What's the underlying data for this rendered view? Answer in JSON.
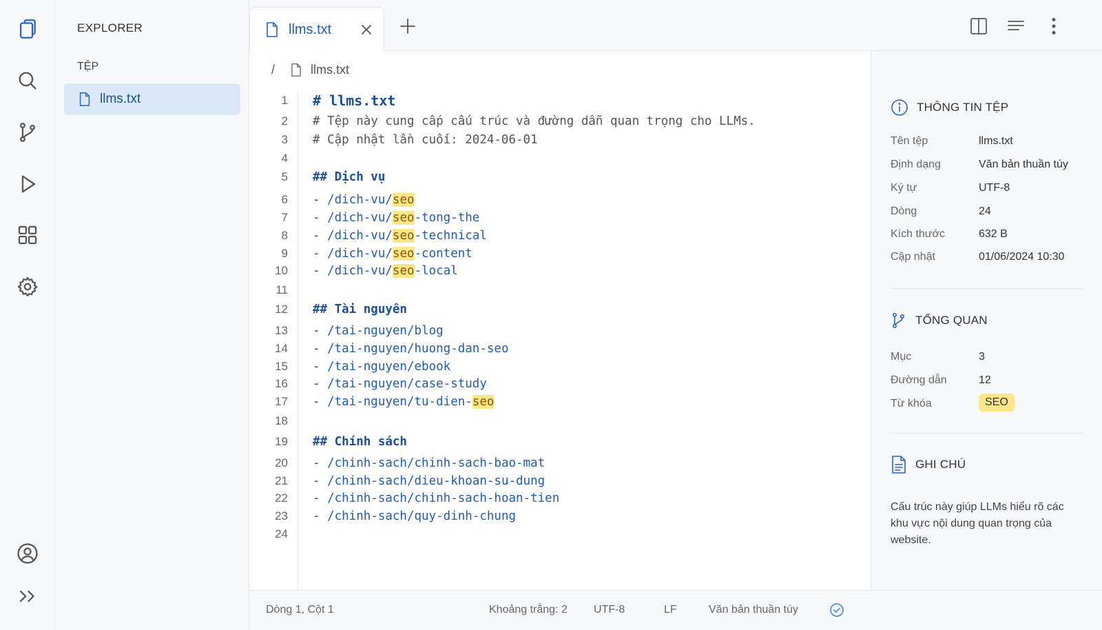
{
  "explorer": {
    "title": "EXPLORER",
    "section": "TỆP",
    "file": "llms.txt"
  },
  "tab": {
    "label": "llms.txt"
  },
  "breadcrumb": {
    "separator": "/",
    "file": "llms.txt"
  },
  "editor": {
    "lines": [
      {
        "n": "1",
        "parts": [
          [
            "h1",
            "# llms.txt"
          ]
        ]
      },
      {
        "n": "2",
        "parts": [
          [
            "cm",
            "# Tệp này cung cấp cấu trúc và đường dẫn quan trọng cho LLMs."
          ]
        ]
      },
      {
        "n": "3",
        "parts": [
          [
            "cm",
            "# Cập nhật lần cuối: 2024-06-01"
          ]
        ]
      },
      {
        "n": "4",
        "parts": []
      },
      {
        "n": "5",
        "parts": [
          [
            "h2",
            "## Dịch vụ"
          ]
        ]
      },
      {
        "n": "6",
        "parts": [
          [
            "dash",
            "- "
          ],
          [
            "path",
            "/dich-vu/"
          ],
          [
            "hl",
            "seo"
          ]
        ]
      },
      {
        "n": "7",
        "parts": [
          [
            "dash",
            "- "
          ],
          [
            "path",
            "/dich-vu/"
          ],
          [
            "hl",
            "seo"
          ],
          [
            "path",
            "-tong-the"
          ]
        ]
      },
      {
        "n": "8",
        "parts": [
          [
            "dash",
            "- "
          ],
          [
            "path",
            "/dich-vu/"
          ],
          [
            "hl",
            "seo"
          ],
          [
            "path",
            "-technical"
          ]
        ]
      },
      {
        "n": "9",
        "parts": [
          [
            "dash",
            "- "
          ],
          [
            "path",
            "/dich-vu/"
          ],
          [
            "hl",
            "seo"
          ],
          [
            "path",
            "-content"
          ]
        ]
      },
      {
        "n": "10",
        "parts": [
          [
            "dash",
            "- "
          ],
          [
            "path",
            "/dich-vu/"
          ],
          [
            "hl",
            "seo"
          ],
          [
            "path",
            "-local"
          ]
        ]
      },
      {
        "n": "11",
        "parts": []
      },
      {
        "n": "12",
        "parts": [
          [
            "h2",
            "## Tài nguyên"
          ]
        ]
      },
      {
        "n": "13",
        "parts": [
          [
            "dash",
            "- "
          ],
          [
            "path",
            "/tai-nguyen/blog"
          ]
        ]
      },
      {
        "n": "14",
        "parts": [
          [
            "dash",
            "- "
          ],
          [
            "path",
            "/tai-nguyen/huong-dan-seo"
          ]
        ]
      },
      {
        "n": "15",
        "parts": [
          [
            "dash",
            "- "
          ],
          [
            "path",
            "/tai-nguyen/ebook"
          ]
        ]
      },
      {
        "n": "16",
        "parts": [
          [
            "dash",
            "- "
          ],
          [
            "path",
            "/tai-nguyen/case-study"
          ]
        ]
      },
      {
        "n": "17",
        "parts": [
          [
            "dash",
            "- "
          ],
          [
            "path",
            "/tai-nguyen/tu-dien-"
          ],
          [
            "hl",
            "seo"
          ]
        ]
      },
      {
        "n": "18",
        "parts": []
      },
      {
        "n": "19",
        "parts": [
          [
            "h2",
            "## Chính sách"
          ]
        ]
      },
      {
        "n": "20",
        "parts": [
          [
            "dash",
            "- "
          ],
          [
            "path",
            "/chinh-sach/chinh-sach-bao-mat"
          ]
        ]
      },
      {
        "n": "21",
        "parts": [
          [
            "dash",
            "- "
          ],
          [
            "path",
            "/chinh-sach/dieu-khoan-su-dung"
          ]
        ]
      },
      {
        "n": "22",
        "parts": [
          [
            "dash",
            "- "
          ],
          [
            "path",
            "/chinh-sach/chinh-sach-hoan-tien"
          ]
        ]
      },
      {
        "n": "23",
        "parts": [
          [
            "dash",
            "- "
          ],
          [
            "path",
            "/chinh-sach/quy-dinh-chung"
          ]
        ]
      },
      {
        "n": "24",
        "parts": []
      }
    ]
  },
  "panel": {
    "file_info": {
      "title": "THÔNG TIN TỆP",
      "rows": [
        {
          "k": "Tên tệp",
          "v": "llms.txt"
        },
        {
          "k": "Định dạng",
          "v": "Văn bản thuần túy"
        },
        {
          "k": "Ký tự",
          "v": "UTF-8"
        },
        {
          "k": "Dòng",
          "v": "24"
        },
        {
          "k": "Kích thước",
          "v": "632 B"
        },
        {
          "k": "Cập nhật",
          "v": "01/06/2024 10:30"
        }
      ]
    },
    "overview": {
      "title": "TỔNG QUAN",
      "rows": [
        {
          "k": "Mục",
          "v": "3"
        },
        {
          "k": "Đường dẫn",
          "v": "12"
        }
      ],
      "keyword_label": "Từ khóa",
      "keyword": "SEO"
    },
    "notes": {
      "title": "GHI CHÚ",
      "text": "Cấu trúc này giúp LLMs hiểu rõ các khu vực nội dung quan trọng của website."
    }
  },
  "status": {
    "position": "Dòng 1, Cột 1",
    "indent": "Khoảng trắng: 2",
    "encoding": "UTF-8",
    "eol": "LF",
    "language": "Văn bản thuần túy"
  },
  "icons": {
    "activity": [
      "files-icon",
      "search-icon",
      "source-control-icon",
      "run-icon",
      "extensions-icon",
      "settings-icon",
      "account-icon",
      "expand-icon"
    ]
  },
  "colors": {
    "accent": "#2563c9",
    "highlight": "#fde68a",
    "selection": "#dbe8fa"
  }
}
